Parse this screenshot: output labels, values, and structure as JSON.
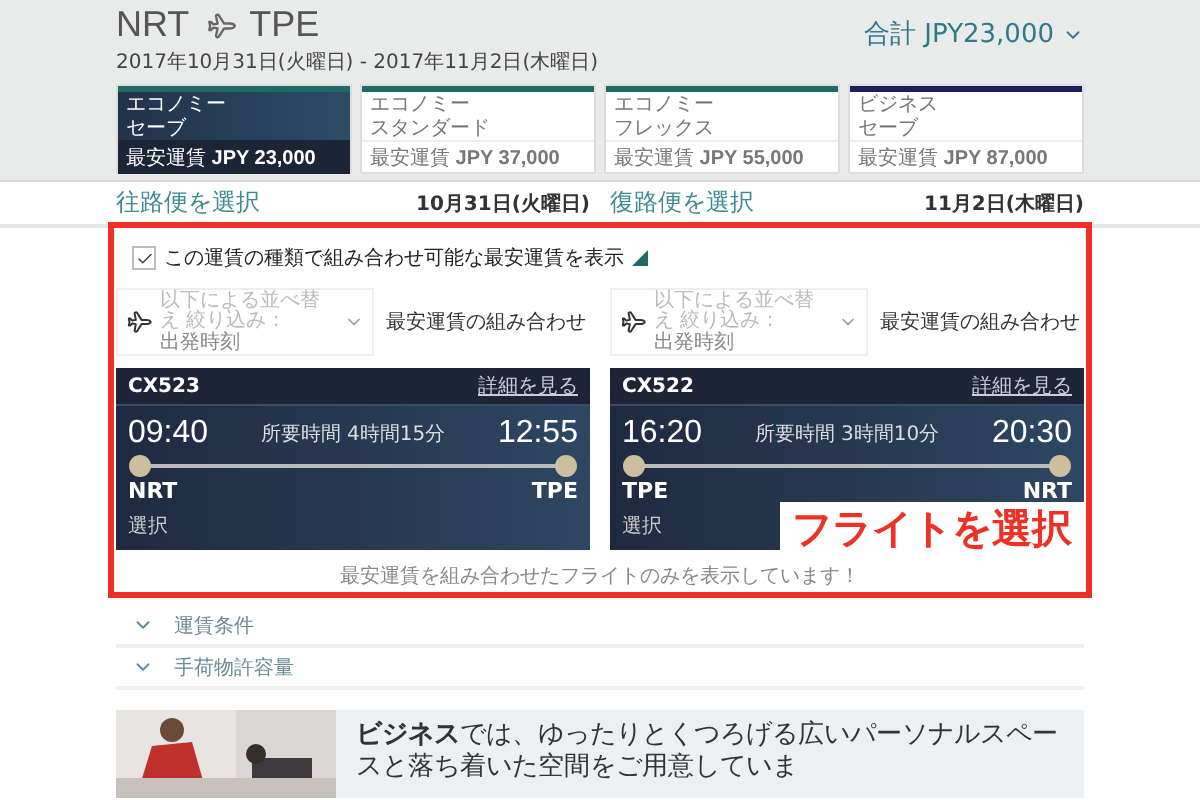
{
  "header": {
    "origin": "NRT",
    "destination": "TPE",
    "dates": "2017年10月31日(火曜日) - 2017年11月2日(木曜日)",
    "total": "合計 JPY23,000"
  },
  "fares": [
    {
      "cabin": "エコノミー",
      "type": "セーブ",
      "label": "最安運賃",
      "price": "JPY 23,000",
      "selected": true,
      "color": "#1f6b63"
    },
    {
      "cabin": "エコノミー",
      "type": "スタンダード",
      "label": "最安運賃",
      "price": "JPY 37,000",
      "selected": false,
      "color": "#1f6b63"
    },
    {
      "cabin": "エコノミー",
      "type": "フレックス",
      "label": "最安運賃",
      "price": "JPY 55,000",
      "selected": false,
      "color": "#1f6b63"
    },
    {
      "cabin": "ビジネス",
      "type": "セーブ",
      "label": "最安運賃",
      "price": "JPY 87,000",
      "selected": false,
      "color": "#1b1f5a"
    }
  ],
  "legs": [
    {
      "title": "往路便を選択",
      "date": "10月31日(火曜日)"
    },
    {
      "title": "復路便を選択",
      "date": "11月2日(木曜日)"
    }
  ],
  "combine": {
    "label": "この運賃の種類で組み合わせ可能な最安運賃を表示",
    "checked": true
  },
  "sorts": [
    {
      "hint": "以下による並べ替え 絞り込み :",
      "value": "出発時刻",
      "button": "最安運賃の組み合わせ"
    },
    {
      "hint": "以下による並べ替え 絞り込み :",
      "value": "出発時刻",
      "button": "最安運賃の組み合わせ"
    }
  ],
  "flights": [
    {
      "number": "CX523",
      "details": "詳細を見る",
      "depart": "09:40",
      "duration": "所要時間 4時間15分",
      "arrive": "12:55",
      "from": "NRT",
      "to": "TPE",
      "select": "選択"
    },
    {
      "number": "CX522",
      "details": "詳細を見る",
      "depart": "16:20",
      "duration": "所要時間 3時間10分",
      "arrive": "20:30",
      "from": "TPE",
      "to": "NRT",
      "select": "選択"
    }
  ],
  "note": "最安運賃を組み合わせたフライトのみを表示しています！",
  "accordions": [
    {
      "label": "運賃条件",
      "expanded": false
    },
    {
      "label": "手荷物許容量",
      "expanded": false
    }
  ],
  "promo": {
    "kind": "picture",
    "text": "**ビジネス**では、ゆったりとくつろげる広いパーソナルスペースと落ち着いた空間をご用意していま"
  },
  "annotation": {
    "label": "フライトを選択"
  }
}
